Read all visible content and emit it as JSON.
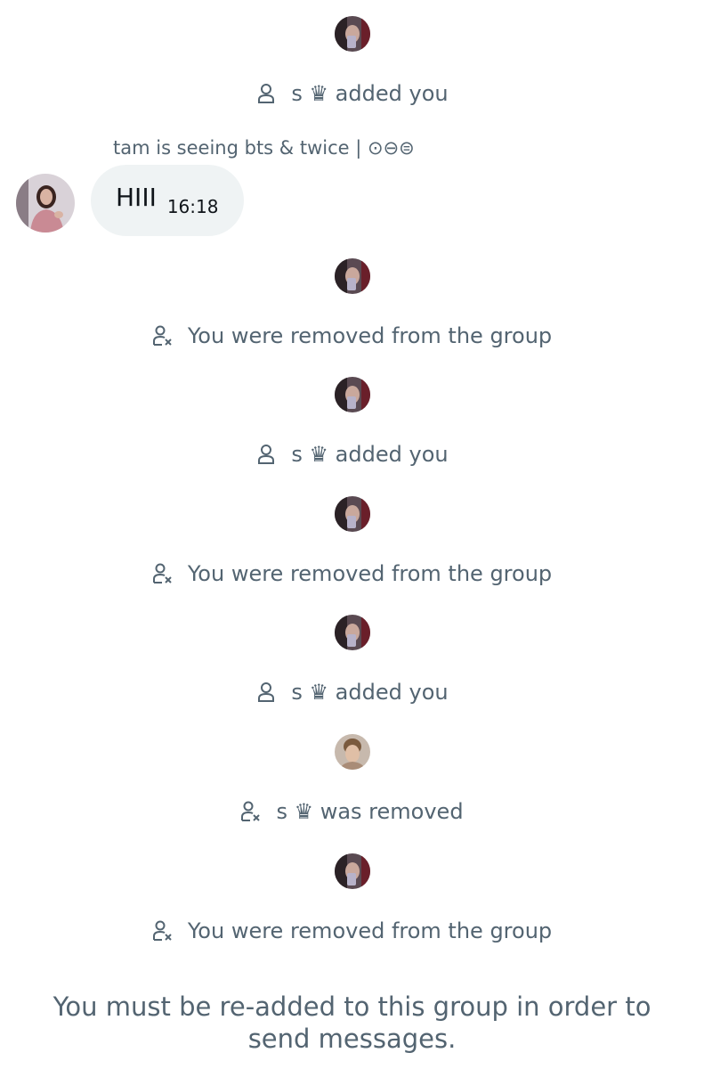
{
  "events": [
    {
      "type": "added",
      "avatar": "member-s-avatar",
      "text": "s ♛ added you"
    },
    {
      "type": "removed",
      "avatar": "member-s-avatar",
      "text": "You were removed from the group"
    },
    {
      "type": "added",
      "avatar": "member-s-avatar",
      "text": "s ♛ added you"
    },
    {
      "type": "removed",
      "avatar": "member-s-avatar",
      "text": "You were removed from the group"
    },
    {
      "type": "added",
      "avatar": "member-s-avatar",
      "text": "s ♛ added you"
    },
    {
      "type": "removed",
      "avatar": "member-other-avatar",
      "text": "s ♛ was removed"
    },
    {
      "type": "removed",
      "avatar": "member-s-avatar",
      "text": "You were removed from the group"
    }
  ],
  "message": {
    "sender_name": "tam is seeing bts & twice | ⊙⊖⊜",
    "text": "HIII",
    "time": "16:18"
  },
  "footer": {
    "line1": "You must be re-added to this group in order to",
    "line2": "send messages."
  },
  "colors": {
    "secondary_text": "#536471",
    "primary_text": "#0f1419",
    "bubble_bg": "#eff3f4"
  },
  "icons": {
    "added": "person-icon",
    "removed": "person-remove-icon"
  }
}
